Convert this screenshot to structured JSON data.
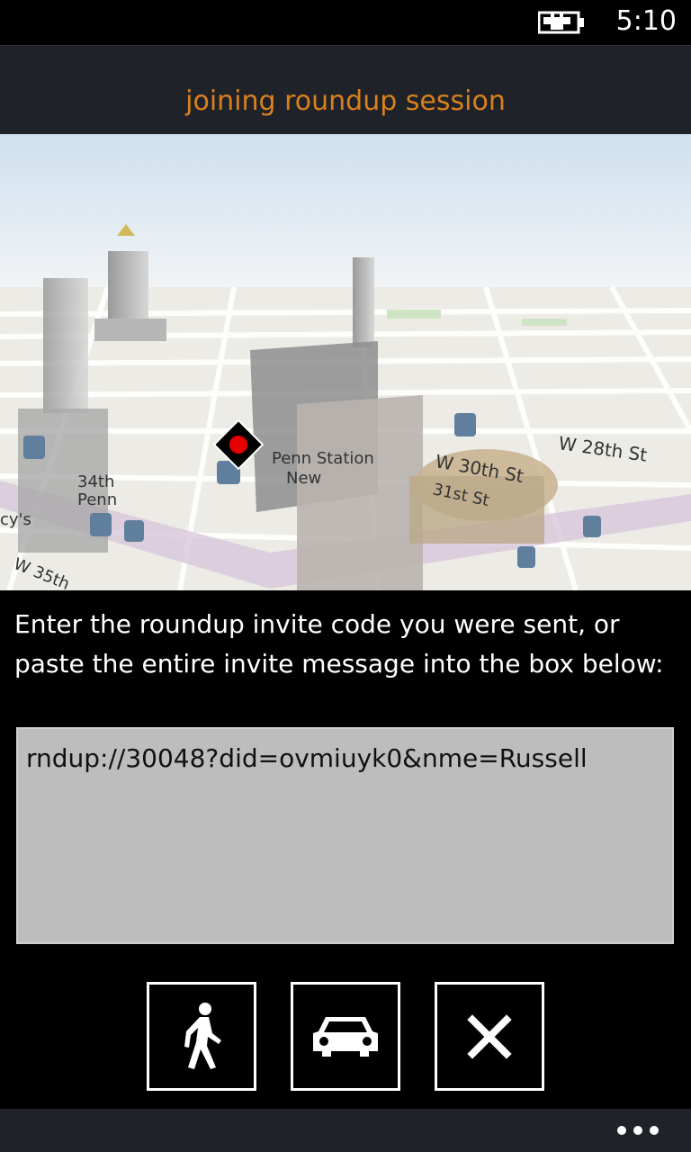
{
  "status_bar": {
    "time": "5:10",
    "battery_icon": "battery-charging-icon"
  },
  "header": {
    "title": "joining roundup session"
  },
  "map": {
    "street_labels": [
      "W 28th St",
      "W 30th St",
      "31st St",
      "W 35th",
      "34th",
      "Penn",
      "Penn Station",
      "New",
      "cy's"
    ],
    "marker": "location-marker-icon"
  },
  "prompt": {
    "text": "Enter the roundup invite code you were sent, or paste the entire invite message into the box below:"
  },
  "invite_input": {
    "value": "rndup://30048?did=ovmiuyk0&nme=Russell"
  },
  "actions": {
    "walk_icon": "walking-person-icon",
    "car_icon": "car-icon",
    "cancel_icon": "close-icon"
  },
  "app_bar": {
    "more_icon": "ellipsis-icon"
  },
  "colors": {
    "accent": "#d9801e",
    "title_bar": "#1f2228",
    "input_bg": "#bdbdbd"
  }
}
